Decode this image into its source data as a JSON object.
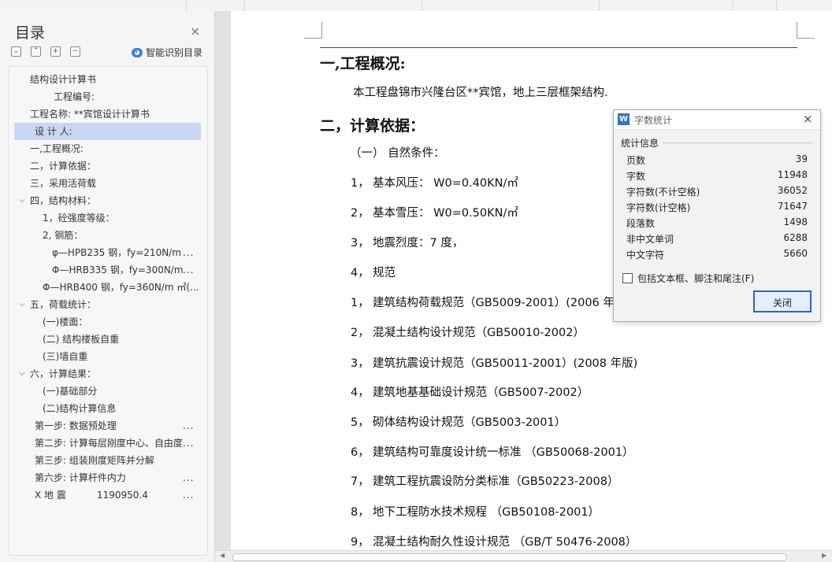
{
  "sidebar": {
    "title": "目录",
    "close_glyph": "×",
    "tools": [
      "⌄",
      "⌃",
      "+",
      "−"
    ],
    "smart_label": "智能识别目录",
    "items": [
      {
        "text": "结构设计计算书",
        "caret": "",
        "more": "",
        "value": ""
      },
      {
        "text": "工程编号:",
        "caret": "",
        "more": "",
        "value": ""
      },
      {
        "text": "工程名称: **宾馆设计计算书",
        "caret": "",
        "more": "",
        "value": ""
      },
      {
        "text": "设 计 人:",
        "caret": "",
        "more": "",
        "value": ""
      },
      {
        "text": "一,工程概况:",
        "caret": "",
        "more": "",
        "value": ""
      },
      {
        "text": "二，计算依据：",
        "caret": "",
        "more": "",
        "value": ""
      },
      {
        "text": "三，采用活荷载",
        "caret": "",
        "more": "",
        "value": ""
      },
      {
        "text": "四，结构材料：",
        "caret": "⌵",
        "more": "",
        "value": ""
      },
      {
        "text": "1，砼强度等级：",
        "caret": "",
        "more": "",
        "value": ""
      },
      {
        "text": "2,      钢筋：",
        "caret": "",
        "more": "",
        "value": ""
      },
      {
        "text": "φ—HPB235 钢，fy=210N/m",
        "caret": "",
        "more": "...",
        "value": ""
      },
      {
        "text": "Φ—HRB335 钢，fy=300N/m",
        "caret": "",
        "more": "...",
        "value": ""
      },
      {
        "text": "Φ—HRB400 钢，fy=360N/m ㎡(...",
        "caret": "",
        "more": "",
        "value": ""
      },
      {
        "text": "五，荷载统计：",
        "caret": "⌵",
        "more": "",
        "value": ""
      },
      {
        "text": "(一)楼面：",
        "caret": "",
        "more": "",
        "value": ""
      },
      {
        "text": "(二) 结构楼板自重",
        "caret": "",
        "more": "",
        "value": ""
      },
      {
        "text": "(三)墙自重",
        "caret": "",
        "more": "",
        "value": ""
      },
      {
        "text": "六，计算结果：",
        "caret": "⌵",
        "more": "",
        "value": ""
      },
      {
        "text": "(一)基础部分",
        "caret": "",
        "more": "",
        "value": ""
      },
      {
        "text": "(二)结构计算信息",
        "caret": "",
        "more": "",
        "value": ""
      },
      {
        "text": "第一步: 数据预处理",
        "caret": "",
        "more": "...",
        "value": ""
      },
      {
        "text": "第二步: 计算每层刚度中心、自由度",
        "caret": "",
        "more": "...",
        "value": ""
      },
      {
        "text": "第三步: 组装刚度矩阵并分解",
        "caret": "",
        "more": "",
        "value": ""
      },
      {
        "text": "第六步: 计算杆件内力",
        "caret": "",
        "more": "...",
        "value": ""
      },
      {
        "text": "X 地 震",
        "caret": "",
        "more": "...",
        "value": "1190950.4"
      }
    ]
  },
  "document": {
    "lines": [
      {
        "text": "一,工程概况:",
        "kind": "h1"
      },
      {
        "text": "本工程盘锦市兴隆台区**宾馆，地上三层框架结构.",
        "kind": "body"
      },
      {
        "text": "二，计算依据：",
        "kind": "h1"
      },
      {
        "text": "（一） 自然条件：",
        "kind": "body"
      },
      {
        "num": "1，",
        "text": "基本风压： W0=0.40KN/㎡",
        "kind": "body"
      },
      {
        "num": "2，",
        "text": "基本雪压： W0=0.50KN/㎡",
        "kind": "body"
      },
      {
        "num": "3，",
        "text": "地震烈度：7 度，",
        "kind": "body"
      },
      {
        "num": "4，",
        "text": "规范",
        "kind": "body"
      },
      {
        "num": "1，",
        "text": "建筑结构荷载规范（GB5009-2001）(2006 年",
        "kind": "body"
      },
      {
        "num": "2，",
        "text": "混凝土结构设计规范（GB50010-2002）",
        "kind": "body"
      },
      {
        "num": "3，",
        "text": "建筑抗震设计规范（GB50011-2001）(2008 年版)",
        "kind": "body"
      },
      {
        "num": "4，",
        "text": "建筑地基基础设计规范（GB5007-2002）",
        "kind": "body"
      },
      {
        "num": "5，",
        "text": "砌体结构设计规范（GB5003-2001）",
        "kind": "body"
      },
      {
        "num": "6，",
        "text": "建筑结构可靠度设计统一标准 （GB50068-2001）",
        "kind": "body"
      },
      {
        "num": "7，",
        "text": "建筑工程抗震设防分类标准（GB50223-2008）",
        "kind": "body"
      },
      {
        "num": "8，",
        "text": "地下工程防水技术规程 （GB50108-2001）",
        "kind": "body"
      },
      {
        "num": "9，",
        "text": "混凝土结构耐久性设计规范 （GB/T 50476-2008）",
        "kind": "body"
      }
    ]
  },
  "dialog": {
    "icon_letter": "W",
    "title": "字数统计",
    "close_glyph": "×",
    "section": "统计信息",
    "stats": [
      {
        "label": "页数",
        "value": "39"
      },
      {
        "label": "字数",
        "value": "11948"
      },
      {
        "label": "字符数(不计空格)",
        "value": "36052"
      },
      {
        "label": "字符数(计空格)",
        "value": "71647"
      },
      {
        "label": "段落数",
        "value": "1498"
      },
      {
        "label": "非中文单词",
        "value": "6288"
      },
      {
        "label": "中文字符",
        "value": "5660"
      }
    ],
    "checkbox_label": "包括文本框、脚注和尾注(F)",
    "close_button": "关闭"
  },
  "colors": {
    "selected_item": "#c9d7f2",
    "dialog_button_border": "#2d64c8",
    "smart_icon": "#3b7de0"
  }
}
